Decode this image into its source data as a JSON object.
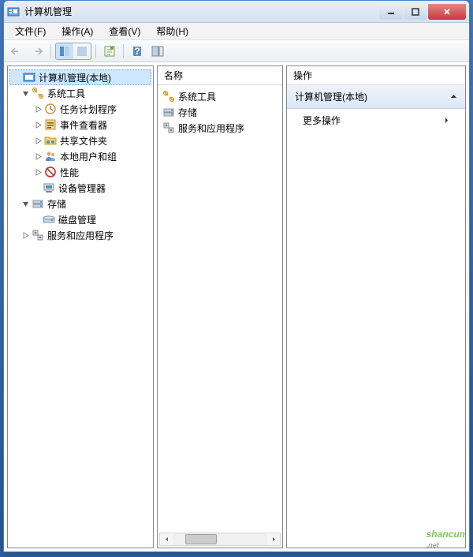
{
  "window": {
    "title": "计算机管理"
  },
  "menubar": {
    "file": "文件(F)",
    "action": "操作(A)",
    "view": "查看(V)",
    "help": "帮助(H)"
  },
  "tree": {
    "root": "计算机管理(本地)",
    "nodes": {
      "system_tools": "系统工具",
      "task_scheduler": "任务计划程序",
      "event_viewer": "事件查看器",
      "shared_folders": "共享文件夹",
      "local_users": "本地用户和组",
      "performance": "性能",
      "device_manager": "设备管理器",
      "storage": "存储",
      "disk_management": "磁盘管理",
      "services_apps": "服务和应用程序"
    }
  },
  "list": {
    "header": "名称",
    "items": {
      "system_tools": "系统工具",
      "storage": "存储",
      "services_apps": "服务和应用程序"
    }
  },
  "actions": {
    "header": "操作",
    "section": "计算机管理(本地)",
    "more": "更多操作"
  },
  "watermark": {
    "text": "shancun",
    "sub": ".net"
  }
}
